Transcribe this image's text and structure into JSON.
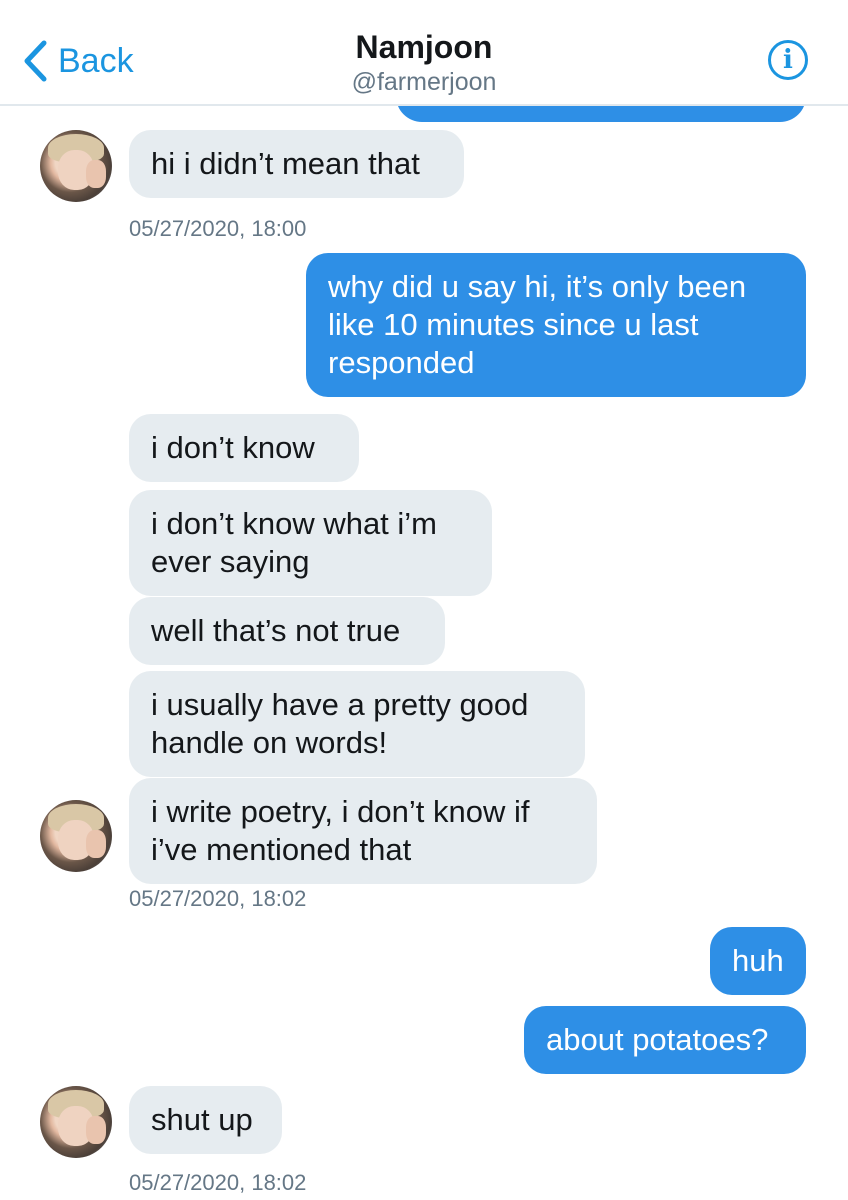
{
  "header": {
    "back_label": "Back",
    "name": "Namjoon",
    "handle": "@farmerjoon",
    "info_icon": "i"
  },
  "messages": [
    {
      "side": "in",
      "text": "hi i didn’t mean that"
    },
    {
      "side": "out",
      "text": "why did u say hi, it’s only been like 10 minutes since u last responded"
    },
    {
      "side": "in",
      "text": "i don’t know"
    },
    {
      "side": "in",
      "text": "i don’t know what i’m ever saying"
    },
    {
      "side": "in",
      "text": "well that’s not true"
    },
    {
      "side": "in",
      "text": "i usually have a pretty good handle on words!"
    },
    {
      "side": "in",
      "text": "i write poetry, i don’t know if i’ve mentioned that"
    },
    {
      "side": "out",
      "text": "huh"
    },
    {
      "side": "out",
      "text": "about potatoes?"
    },
    {
      "side": "in",
      "text": "shut up"
    }
  ],
  "timestamps": [
    "05/27/2020, 18:00",
    "05/27/2020, 18:02",
    "05/27/2020, 18:02"
  ],
  "colors": {
    "accent": "#1b95e0",
    "outgoing_bubble": "#2e8fe6",
    "incoming_bubble": "#e6ecf0"
  }
}
